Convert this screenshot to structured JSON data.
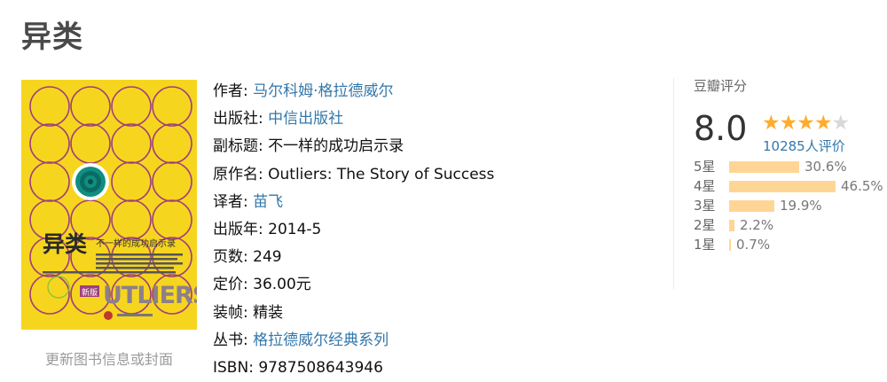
{
  "title": "异类",
  "cover": {
    "title_text": "异类",
    "subtitle_text": "不一样的成功启示录",
    "edition_badge": "新版",
    "english_title": "UTLIERS",
    "bg_color": "#f6d51f",
    "ring_color": "#a0407a",
    "center_color": "#0e8f82"
  },
  "update_link": "更新图书信息或封面",
  "info": [
    {
      "key": "作者",
      "value": "马尔科姆·格拉德威尔",
      "link": true
    },
    {
      "key": "出版社",
      "value": "中信出版社",
      "link": true
    },
    {
      "key": "副标题",
      "value": "不一样的成功启示录",
      "link": false
    },
    {
      "key": "原作名",
      "value": "Outliers: The Story of Success",
      "link": false
    },
    {
      "key": "译者",
      "value": "苗飞",
      "link": true
    },
    {
      "key": "出版年",
      "value": "2014-5",
      "link": false
    },
    {
      "key": "页数",
      "value": "249",
      "link": false
    },
    {
      "key": "定价",
      "value": "36.00元",
      "link": false
    },
    {
      "key": "装帧",
      "value": "精装",
      "link": false
    },
    {
      "key": "丛书",
      "value": "格拉德威尔经典系列",
      "link": true
    },
    {
      "key": "ISBN",
      "value": "9787508643946",
      "link": false
    }
  ],
  "rating": {
    "label": "豆瓣评分",
    "score": "8.0",
    "stars": 4,
    "votes": "10285人评价",
    "breakdown": [
      {
        "label": "5星",
        "percent": "30.6%",
        "value": 30.6
      },
      {
        "label": "4星",
        "percent": "46.5%",
        "value": 46.5
      },
      {
        "label": "3星",
        "percent": "19.9%",
        "value": 19.9
      },
      {
        "label": "2星",
        "percent": "2.2%",
        "value": 2.2
      },
      {
        "label": "1星",
        "percent": "0.7%",
        "value": 0.7
      }
    ]
  },
  "colors": {
    "link": "#3377aa",
    "star": "#ffac2d",
    "bar": "#ffd596"
  }
}
